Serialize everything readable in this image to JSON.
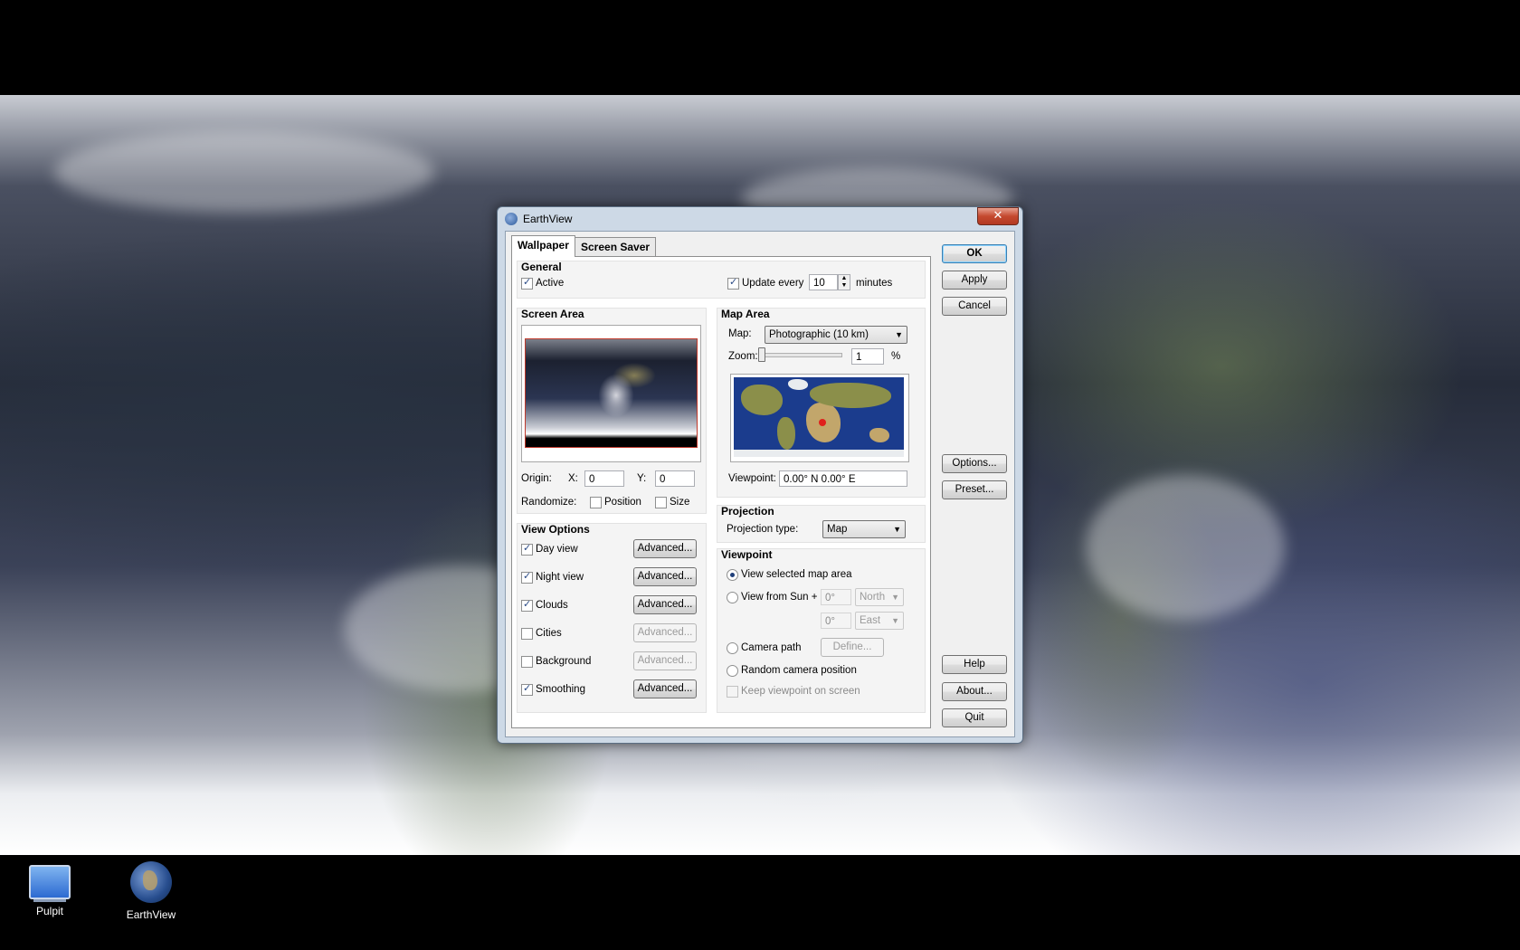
{
  "desktop": {
    "icons": [
      {
        "label": "Pulpit"
      },
      {
        "label": "EarthView"
      }
    ]
  },
  "dialog": {
    "title": "EarthView",
    "close_symbol": "✕",
    "tabs": [
      {
        "label": "Wallpaper",
        "active": true
      },
      {
        "label": "Screen Saver",
        "active": false
      }
    ],
    "general": {
      "title": "General",
      "active_label": "Active",
      "active_checked": true,
      "update_label": "Update every",
      "update_checked": true,
      "update_value": "10",
      "minutes_label": "minutes"
    },
    "screen_area": {
      "title": "Screen Area",
      "origin_label": "Origin:",
      "x_label": "X:",
      "x_value": "0",
      "y_label": "Y:",
      "y_value": "0",
      "randomize_label": "Randomize:",
      "position_label": "Position",
      "position_checked": false,
      "size_label": "Size",
      "size_checked": false
    },
    "map_area": {
      "title": "Map Area",
      "map_label": "Map:",
      "map_value": "Photographic (10 km)",
      "zoom_label": "Zoom:",
      "zoom_value": "1",
      "zoom_unit": "%",
      "viewpoint_label": "Viewpoint:",
      "viewpoint_value": "0.00° N  0.00° E"
    },
    "view_options": {
      "title": "View Options",
      "advanced_label": "Advanced...",
      "items": [
        {
          "label": "Day view",
          "checked": true,
          "advanced_enabled": true
        },
        {
          "label": "Night view",
          "checked": true,
          "advanced_enabled": true
        },
        {
          "label": "Clouds",
          "checked": true,
          "advanced_enabled": true
        },
        {
          "label": "Cities",
          "checked": false,
          "advanced_enabled": false
        },
        {
          "label": "Background",
          "checked": false,
          "advanced_enabled": false
        },
        {
          "label": "Smoothing",
          "checked": true,
          "advanced_enabled": true
        }
      ]
    },
    "projection": {
      "title": "Projection",
      "type_label": "Projection type:",
      "type_value": "Map"
    },
    "viewpoint": {
      "title": "Viewpoint",
      "view_selected_label": "View selected map area",
      "view_from_sun_label": "View from Sun +",
      "lat_value": "0°",
      "lat_dir": "North",
      "lon_value": "0°",
      "lon_dir": "East",
      "camera_path_label": "Camera path",
      "define_label": "Define...",
      "random_camera_label": "Random camera position",
      "keep_viewpoint_label": "Keep viewpoint on screen",
      "selected": "view_selected"
    },
    "buttons": {
      "ok": "OK",
      "apply": "Apply",
      "cancel": "Cancel",
      "options": "Options...",
      "preset": "Preset...",
      "help": "Help",
      "about": "About...",
      "quit": "Quit"
    }
  }
}
